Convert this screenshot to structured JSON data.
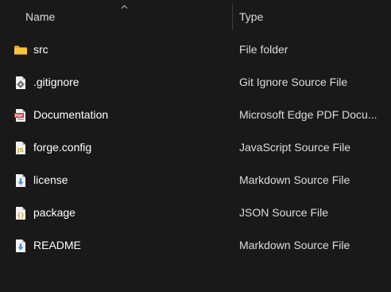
{
  "header": {
    "name_label": "Name",
    "type_label": "Type",
    "sort_icon": "sort-ascending-icon"
  },
  "files": [
    {
      "name": "src",
      "type": "File folder",
      "icon": "folder-icon"
    },
    {
      "name": ".gitignore",
      "type": "Git Ignore Source File",
      "icon": "gear-file-icon"
    },
    {
      "name": "Documentation",
      "type": "Microsoft Edge PDF Docu...",
      "icon": "pdf-file-icon"
    },
    {
      "name": "forge.config",
      "type": "JavaScript Source File",
      "icon": "js-file-icon"
    },
    {
      "name": "license",
      "type": "Markdown Source File",
      "icon": "markdown-file-icon"
    },
    {
      "name": "package",
      "type": "JSON Source File",
      "icon": "json-file-icon"
    },
    {
      "name": "README",
      "type": "Markdown Source File",
      "icon": "markdown-file-icon"
    }
  ],
  "colors": {
    "background": "#191919",
    "text": "#ffffff",
    "secondary_text": "#dcdcdc",
    "folder": "#f8c53a",
    "pdf": "#c8312f",
    "js": "#e8c33a",
    "markdown_arrow": "#4a8fd9"
  }
}
